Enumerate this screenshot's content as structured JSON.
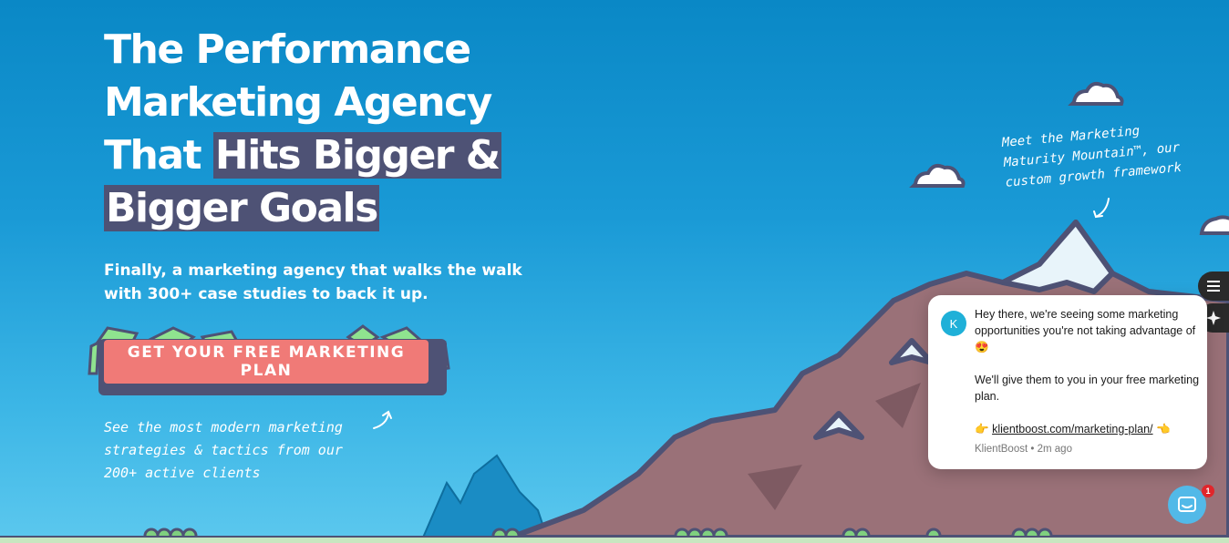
{
  "hero": {
    "title_plain": "The Performance Marketing Agency That ",
    "title_highlight": "Hits Bigger & Bigger Goals",
    "subtitle": "Finally, a marketing agency that walks the walk with 300+ case studies to back it up.",
    "cta_label": "GET YOUR FREE MARKETING PLAN"
  },
  "notes": {
    "left": [
      "See the most modern marketing",
      "strategies & tactics from our",
      "200+ active clients"
    ],
    "right": [
      "Meet the Marketing",
      "Maturity Mountain™, our",
      "custom growth framework"
    ]
  },
  "chat": {
    "avatar_letter": "K",
    "message_1": "Hey there, we're seeing some marketing opportunities you're not taking advantage of 😍",
    "message_2": "We'll give them to you in your free marketing plan.",
    "link_prefix": "👉",
    "link_text": "klientboost.com/marketing-plan/",
    "link_suffix": "👈",
    "sender": "KlientBoost",
    "time": "2m ago",
    "unread_count": "1"
  },
  "side_buttons": [
    {
      "icon": "list-icon"
    },
    {
      "icon": "sparkle-icon"
    }
  ],
  "colors": {
    "sky_top": "#0a88c6",
    "highlight": "#4e5275",
    "cta": "#f07a77",
    "mountain": "#9a7178",
    "outline": "#4e5275"
  }
}
